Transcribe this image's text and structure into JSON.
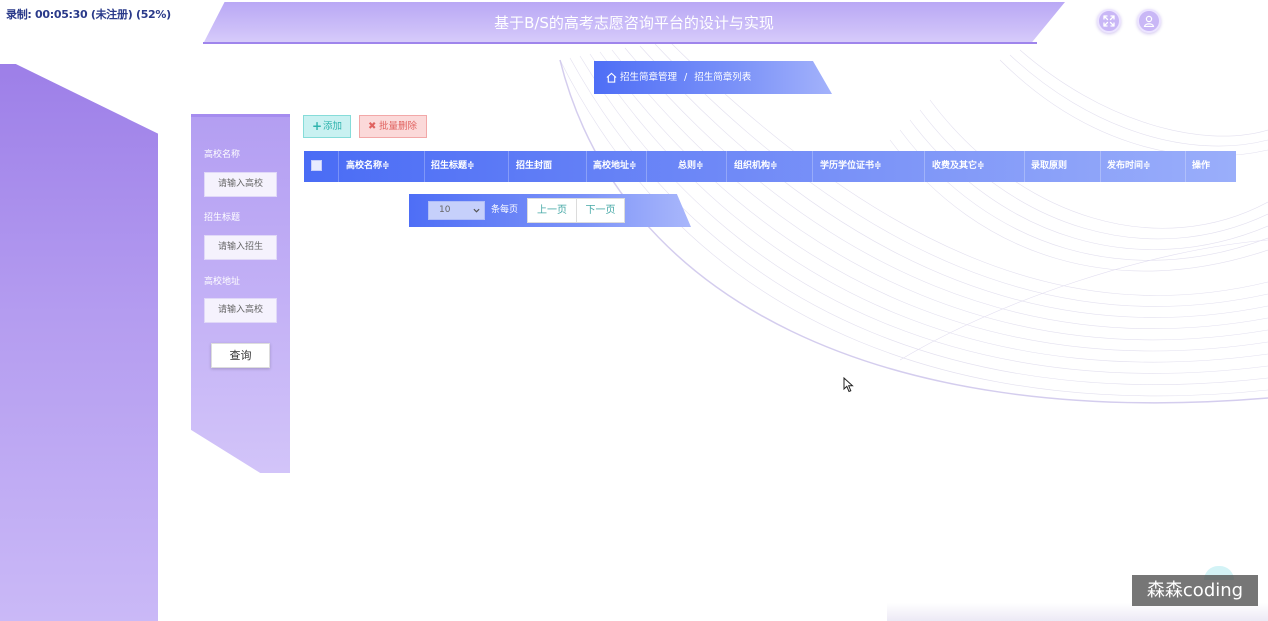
{
  "recording": {
    "text": "录制: 00:05:30 (未注册) (52%)"
  },
  "header": {
    "title": "基于B/S的高考志愿咨询平台的设计与实现"
  },
  "icons": {
    "fullscreen": "fullscreen-icon",
    "user": "user-icon"
  },
  "breadcrumb": {
    "home": "招生简章管理",
    "separator": "/",
    "current": "招生简章列表"
  },
  "search": {
    "fields": [
      {
        "label": "高校名称",
        "placeholder": "请输入高校"
      },
      {
        "label": "招生标题",
        "placeholder": "请输入招生"
      },
      {
        "label": "高校地址",
        "placeholder": "请输入高校"
      }
    ],
    "button": "查询"
  },
  "toolbar": {
    "add": "添加",
    "batch_delete": "批量删除"
  },
  "table": {
    "columns": [
      "高校名称≑",
      "招生标题≑",
      "招生封面",
      "高校地址≑",
      "总则≑",
      "组织机构≑",
      "学历学位证书≑",
      "收费及其它≑",
      "录取原则",
      "发布时间≑",
      "操作"
    ]
  },
  "pager": {
    "page_size": "10",
    "per_page_label": "条每页",
    "prev": "上一页",
    "next": "下一页"
  },
  "watermark": "森森coding",
  "colors": {
    "accent_blue": "#4a6cf5",
    "panel_purple": "#b39ef2",
    "add_green": "#2fb3ad",
    "delete_red": "#e0625f"
  }
}
